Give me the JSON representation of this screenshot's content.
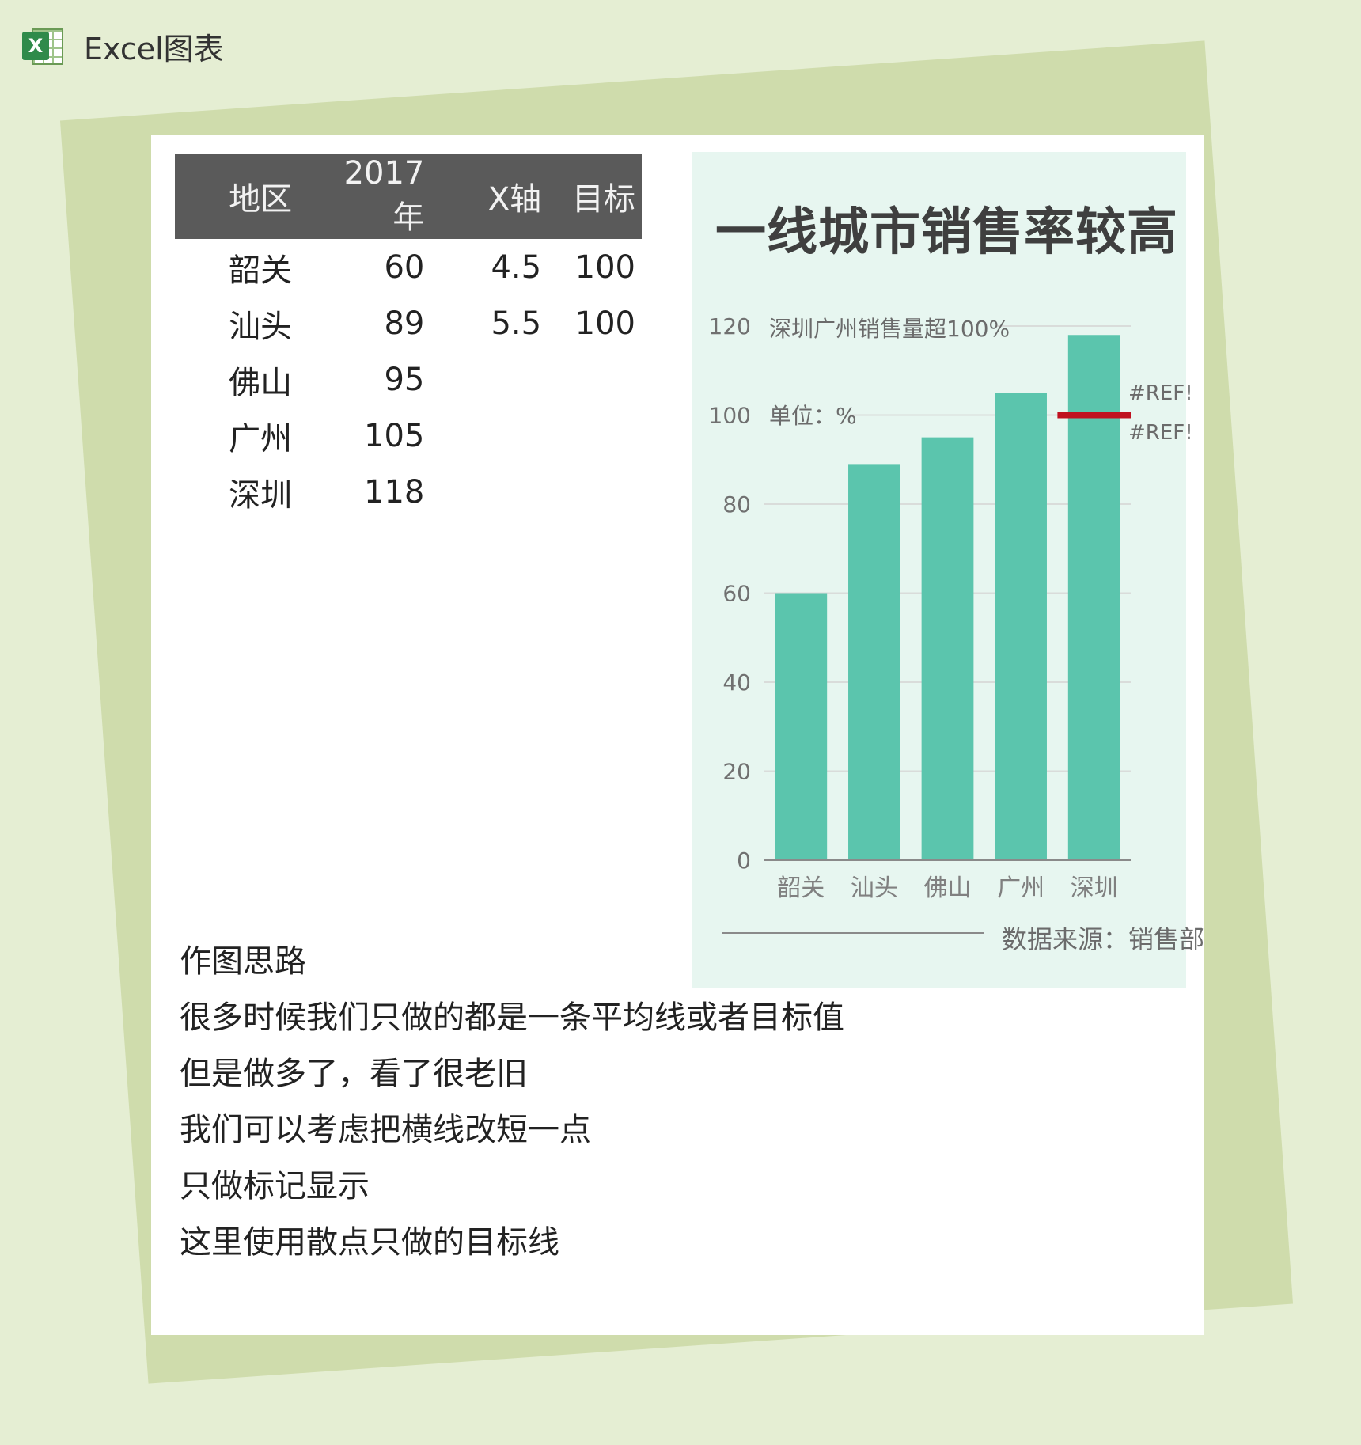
{
  "header": {
    "title": "Excel图表",
    "logo_letter": "X"
  },
  "table": {
    "headers": [
      "地区",
      "2017年",
      "X轴",
      "目标"
    ],
    "rows": [
      [
        "韶关",
        "60",
        "4.5",
        "100"
      ],
      [
        "汕头",
        "89",
        "5.5",
        "100"
      ],
      [
        "佛山",
        "95",
        "",
        ""
      ],
      [
        "广州",
        "105",
        "",
        ""
      ],
      [
        "深圳",
        "118",
        "",
        ""
      ]
    ]
  },
  "notes": [
    "作图思路",
    "很多时候我们只做的都是一条平均线或者目标值",
    "但是做多了，看了很老旧",
    "我们可以考虑把横线改短一点",
    "只做标记显示",
    "这里使用散点只做的目标线"
  ],
  "chart_data": {
    "type": "bar",
    "title": "一线城市销售率较高",
    "categories": [
      "韶关",
      "汕头",
      "佛山",
      "广州",
      "深圳"
    ],
    "values": [
      60,
      89,
      95,
      105,
      118
    ],
    "ylim": [
      0,
      120
    ],
    "yticks": [
      0,
      20,
      40,
      60,
      80,
      100,
      120
    ],
    "grid": true,
    "target": {
      "x": 4.5,
      "x_end": 5.5,
      "y": 100
    },
    "annotations": {
      "headline": "深圳广州销售量超100%",
      "unit": "单位：%",
      "ref_labels": [
        "#REF!",
        "#REF!"
      ]
    },
    "source": "数据来源：销售部",
    "colors": {
      "bar": "#5bc5ad",
      "target": "#c0111f",
      "grid": "#d9dcda",
      "axis": "#8a8a8a"
    }
  }
}
